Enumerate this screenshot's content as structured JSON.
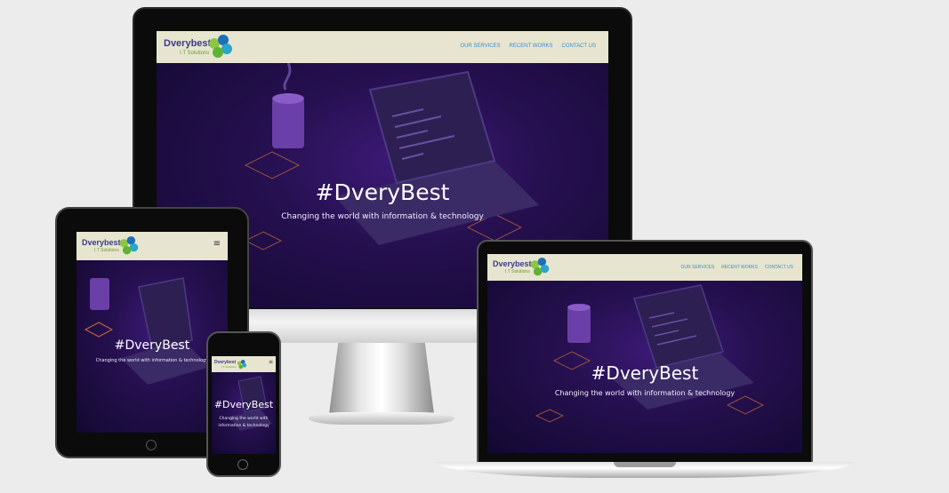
{
  "site": {
    "logo_name": "Dverybest",
    "logo_tagline": "I.T Solutions",
    "nav": [
      {
        "label": "OUR SERVICES"
      },
      {
        "label": "RECENT WORKS"
      },
      {
        "label": "CONTACT US"
      }
    ],
    "hero_title": "#DveryBest",
    "hero_subtitle": "Changing the world with information & technology",
    "hero_subtitle_line1": "Changing the world with",
    "hero_subtitle_line2": "information & technology",
    "menu_icon": "≡"
  },
  "colors": {
    "header_bg": "#e7e5cf",
    "hero_bg": "#1b0c40",
    "logo_text": "#3b3a8c",
    "logo_sub": "#6a9c2f",
    "nav_link": "#3a8bd0",
    "device_frame": "#0d0d0d"
  },
  "icons": [
    "logo-puzzle-icon",
    "hamburger-menu-icon",
    "coffee-cup-icon",
    "laptop-icon"
  ]
}
